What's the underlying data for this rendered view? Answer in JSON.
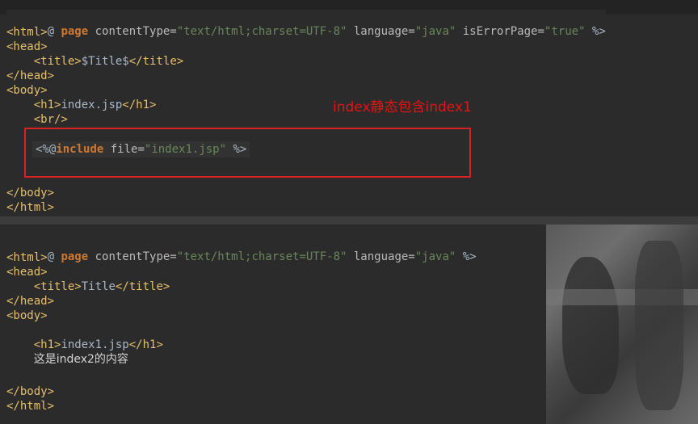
{
  "top_code": {
    "line1": {
      "open": "<%@ ",
      "kw": "page",
      "a1": " contentType=",
      "s1": "\"text/html;charset=UTF-8\"",
      "a2": " language=",
      "s2": "\"java\"",
      "a3": " isErrorPage=",
      "s3": "\"true\"",
      "close": " %>"
    },
    "html_open": "<html>",
    "head_open": "<head>",
    "title_open": "<title>",
    "title_text": "$Title$",
    "title_close": "</title>",
    "head_close": "</head>",
    "body_open": "<body>",
    "h1_open": "<h1>",
    "h1_text": "index.jsp",
    "h1_close": "</h1>",
    "br": "<br/>",
    "include": {
      "open": "<%@",
      "kw": "include",
      "attr": " file=",
      "value": "\"index1.jsp\"",
      "close": " %>"
    },
    "body_close": "</body>",
    "html_close": "</html>"
  },
  "annotation": "index静态包含index1",
  "bottom_code": {
    "line1": {
      "open": "<%@ ",
      "kw": "page",
      "a1": " contentType=",
      "s1": "\"text/html;charset=UTF-8\"",
      "a2": " language=",
      "s2": "\"java\"",
      "close": " %>"
    },
    "html_open": "<html>",
    "head_open": "<head>",
    "title_open": "<title>",
    "title_text": "Title",
    "title_close": "</title>",
    "head_close": "</head>",
    "body_open": "<body>",
    "h1_open": "<h1>",
    "h1_text": "index1.jsp",
    "h1_close": "</h1>",
    "content_text": "这是index2的内容",
    "body_close": "</body>",
    "html_close": "</html>"
  },
  "colors": {
    "background": "#2b2b2b",
    "tag": "#e8bf6a",
    "keyword": "#cc7832",
    "string": "#6a8759",
    "annotation": "#e31414",
    "highlight_box": "#d62222"
  }
}
